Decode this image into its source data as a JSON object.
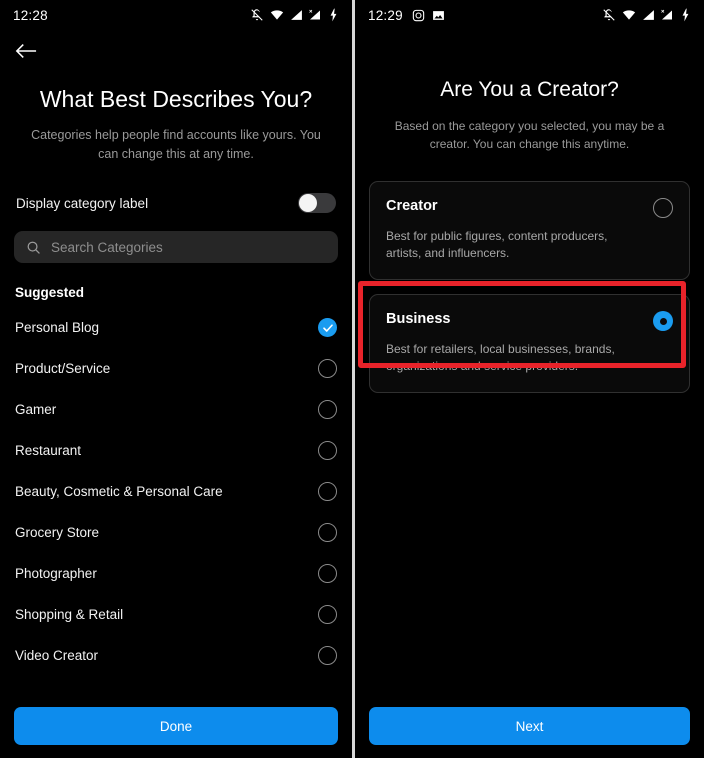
{
  "left_screen": {
    "status_bar": {
      "time": "12:28",
      "right_icons": [
        "bell-off-icon",
        "wifi-icon",
        "signal-icon",
        "signal-no-sim-icon",
        "battery-charging-icon"
      ]
    },
    "back_button": "back-arrow-icon",
    "title": "What Best Describes You?",
    "subtitle": "Categories help people find accounts like yours. You can change this at any time.",
    "toggle": {
      "label": "Display category label",
      "state": "off"
    },
    "search": {
      "placeholder": "Search Categories",
      "value": "",
      "icon": "search-icon"
    },
    "section_header": "Suggested",
    "categories": [
      {
        "label": "Personal Blog",
        "selected": true
      },
      {
        "label": "Product/Service",
        "selected": false
      },
      {
        "label": "Gamer",
        "selected": false
      },
      {
        "label": "Restaurant",
        "selected": false
      },
      {
        "label": "Beauty, Cosmetic & Personal Care",
        "selected": false
      },
      {
        "label": "Grocery Store",
        "selected": false
      },
      {
        "label": "Photographer",
        "selected": false
      },
      {
        "label": "Shopping & Retail",
        "selected": false
      },
      {
        "label": "Video Creator",
        "selected": false
      }
    ],
    "primary_button": "Done"
  },
  "right_screen": {
    "status_bar": {
      "time": "12:29",
      "left_icons": [
        "instagram-icon",
        "photo-icon"
      ],
      "right_icons": [
        "bell-off-icon",
        "wifi-icon",
        "signal-icon",
        "signal-no-sim-icon",
        "battery-charging-icon"
      ]
    },
    "title": "Are You a Creator?",
    "subtitle": "Based on the category you selected, you may be a creator. You can change this anytime.",
    "options": [
      {
        "title": "Creator",
        "description": "Best for public figures, content producers, artists, and influencers.",
        "selected": false
      },
      {
        "title": "Business",
        "description": "Best for retailers, local businesses, brands, organizations and service providers.",
        "selected": true
      }
    ],
    "primary_button": "Next"
  },
  "colors": {
    "accent_blue": "#0d8ced",
    "radio_blue": "#1a9cf0",
    "highlight_red": "#e8232a",
    "background": "#000000",
    "card_border": "#303030",
    "search_bg": "#262626"
  }
}
